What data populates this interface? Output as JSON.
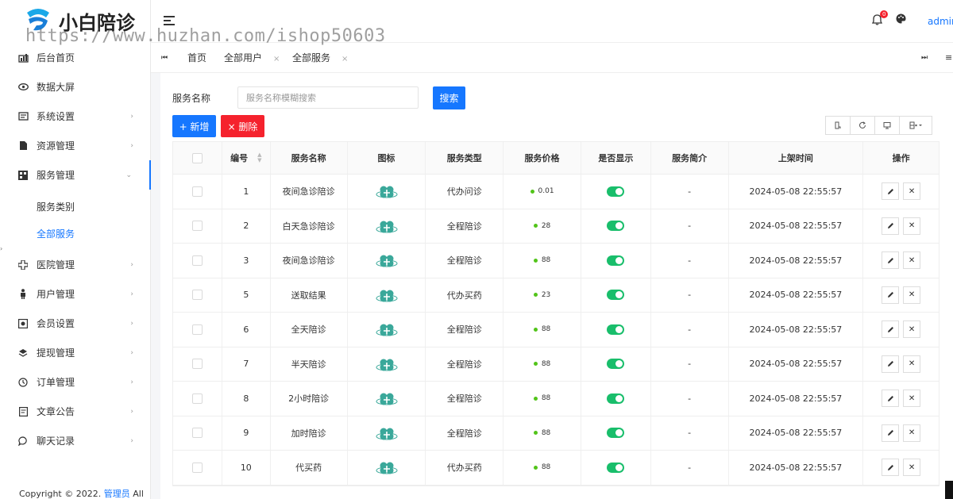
{
  "brand": {
    "name": "小白陪诊",
    "watermark": "https://www.huzhan.com/ishop50603"
  },
  "sidebar": {
    "items": [
      {
        "label": "后台首页",
        "icon": "dashboard-icon",
        "arrow": false
      },
      {
        "label": "数据大屏",
        "icon": "eye-icon",
        "arrow": false
      },
      {
        "label": "系统设置",
        "icon": "settings-icon",
        "arrow": true
      },
      {
        "label": "资源管理",
        "icon": "file-icon",
        "arrow": true
      },
      {
        "label": "服务管理",
        "icon": "grid-icon",
        "arrow": true,
        "open": true
      }
    ],
    "subitems": [
      {
        "label": "服务类别",
        "active": false
      },
      {
        "label": "全部服务",
        "active": true
      }
    ],
    "items2": [
      {
        "label": "医院管理",
        "icon": "plus-icon"
      },
      {
        "label": "用户管理",
        "icon": "user-icon"
      },
      {
        "label": "会员设置",
        "icon": "member-icon"
      },
      {
        "label": "提现管理",
        "icon": "layers-icon"
      },
      {
        "label": "订单管理",
        "icon": "history-icon"
      },
      {
        "label": "文章公告",
        "icon": "article-icon"
      },
      {
        "label": "聊天记录",
        "icon": "chat-icon"
      }
    ],
    "copyright_prefix": "Copyright © 2022.",
    "copyright_link": "管理员",
    "copyright_suffix": "All"
  },
  "topbar": {
    "badge": "0",
    "user": "admin"
  },
  "tabs": [
    {
      "label": "首页",
      "closable": false
    },
    {
      "label": "全部用户",
      "closable": true
    },
    {
      "label": "全部服务",
      "closable": true
    }
  ],
  "filter": {
    "label": "服务名称",
    "placeholder": "服务名称模糊搜索",
    "search_button": "搜索"
  },
  "actions": {
    "add": "+ 新增",
    "delete": "× 删除"
  },
  "table": {
    "headers": [
      "编号",
      "服务名称",
      "图标",
      "服务类型",
      "服务价格",
      "是否显示",
      "服务简介",
      "上架时间",
      "操作"
    ],
    "rows": [
      {
        "id": "1",
        "name": "夜间急诊陪诊",
        "type": "代办问诊",
        "price": "0.01",
        "intro": "-",
        "time": "2024-05-08 22:55:57"
      },
      {
        "id": "2",
        "name": "白天急诊陪诊",
        "type": "全程陪诊",
        "price": "28",
        "intro": "-",
        "time": "2024-05-08 22:55:57"
      },
      {
        "id": "3",
        "name": "夜间急诊陪诊",
        "type": "全程陪诊",
        "price": "88",
        "intro": "-",
        "time": "2024-05-08 22:55:57"
      },
      {
        "id": "5",
        "name": "送取结果",
        "type": "代办买药",
        "price": "23",
        "intro": "-",
        "time": "2024-05-08 22:55:57"
      },
      {
        "id": "6",
        "name": "全天陪诊",
        "type": "全程陪诊",
        "price": "88",
        "intro": "-",
        "time": "2024-05-08 22:55:57"
      },
      {
        "id": "7",
        "name": "半天陪诊",
        "type": "全程陪诊",
        "price": "88",
        "intro": "-",
        "time": "2024-05-08 22:55:57"
      },
      {
        "id": "8",
        "name": "2小时陪诊",
        "type": "全程陪诊",
        "price": "88",
        "intro": "-",
        "time": "2024-05-08 22:55:57"
      },
      {
        "id": "9",
        "name": "加时陪诊",
        "type": "全程陪诊",
        "price": "88",
        "intro": "-",
        "time": "2024-05-08 22:55:57"
      },
      {
        "id": "10",
        "name": "代买药",
        "type": "代办买药",
        "price": "88",
        "intro": "-",
        "time": "2024-05-08 22:55:57"
      }
    ]
  },
  "colors": {
    "primary": "#1677ff",
    "danger": "#f5222d",
    "toggle_on": "#19be6b",
    "icon_teal": "#3aa89a"
  }
}
